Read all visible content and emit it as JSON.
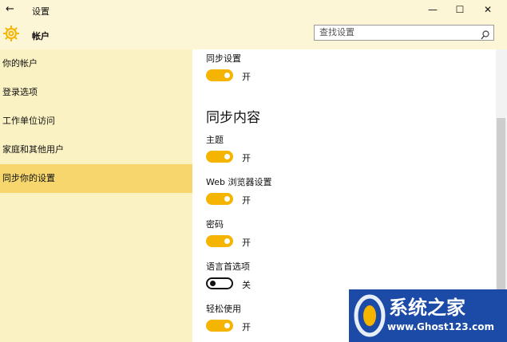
{
  "window": {
    "title": "设置",
    "back_glyph": "←",
    "minimize_glyph": "—",
    "maximize_glyph": "☐",
    "close_glyph": "✕"
  },
  "header": {
    "title": "帐户",
    "icon": "gear-icon",
    "accent": "#f4b400"
  },
  "search": {
    "placeholder": "查找设置",
    "icon": "search-icon"
  },
  "sidebar": {
    "items": [
      {
        "label": "你的帐户",
        "selected": false
      },
      {
        "label": "登录选项",
        "selected": false
      },
      {
        "label": "工作单位访问",
        "selected": false
      },
      {
        "label": "家庭和其他用户",
        "selected": false
      },
      {
        "label": "同步你的设置",
        "selected": true
      }
    ]
  },
  "main": {
    "sync_label": "同步设置",
    "sync_state": "开",
    "sync_on": true,
    "section_heading": "同步内容",
    "items": [
      {
        "label": "主题",
        "state": "开",
        "on": true
      },
      {
        "label": "Web 浏览器设置",
        "state": "开",
        "on": true
      },
      {
        "label": "密码",
        "state": "开",
        "on": true
      },
      {
        "label": "语言首选项",
        "state": "关",
        "on": false
      },
      {
        "label": "轻松使用",
        "state": "开",
        "on": true
      }
    ]
  },
  "watermark": {
    "text": "系统之家",
    "url": "www.Ghost123.com"
  },
  "colors": {
    "toggle_on": "#f4b400",
    "selected_nav": "#f6d66d",
    "sidebar_bg": "#fbf2c3",
    "watermark_bg": "#1b4aa7"
  }
}
